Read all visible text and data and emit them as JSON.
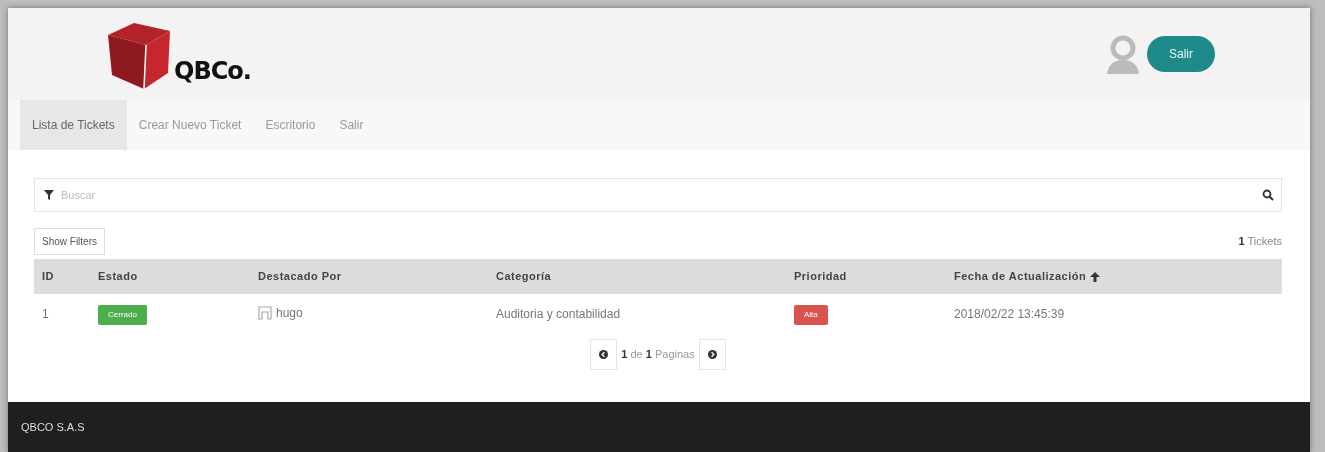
{
  "brand": {
    "name": "QBCo."
  },
  "header": {
    "logout_button": "Salir"
  },
  "nav": [
    {
      "label": "Lista de Tickets",
      "selected": true
    },
    {
      "label": "Crear Nuevo Ticket",
      "selected": false
    },
    {
      "label": "Escritorio",
      "selected": false
    },
    {
      "label": "Salir",
      "selected": false
    }
  ],
  "search": {
    "placeholder": "Buscar"
  },
  "filters_button": "Show Filters",
  "ticket_count": {
    "count": "1",
    "label": "Tickets"
  },
  "table": {
    "columns": [
      {
        "label": "ID",
        "sorted": false
      },
      {
        "label": "Estado",
        "sorted": false
      },
      {
        "label": "Destacado Por",
        "sorted": false
      },
      {
        "label": "Categoría",
        "sorted": false
      },
      {
        "label": "Prioridad",
        "sorted": false
      },
      {
        "label": "Fecha de Actualización",
        "sorted": true
      }
    ],
    "rows": [
      {
        "id": "1",
        "status": {
          "text": "Cerrado",
          "color": "#4cae4c"
        },
        "user": "hugo",
        "category": "Auditoria y contabilidad",
        "priority": {
          "text": "Alta",
          "color": "#d9534f"
        },
        "updated": "2018/02/22 13:45:39"
      }
    ]
  },
  "pagination": {
    "current": "1",
    "of": "de",
    "total": "1",
    "label": "Paginas"
  },
  "footer": {
    "text": "QBCO S.A.S"
  }
}
